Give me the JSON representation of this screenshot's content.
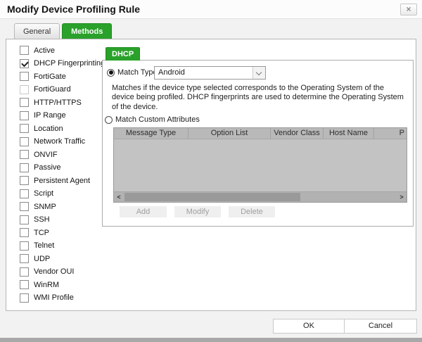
{
  "dialog": {
    "title": "Modify Device Profiling Rule",
    "close_icon": "×"
  },
  "tabs": [
    {
      "label": "General",
      "active": false
    },
    {
      "label": "Methods",
      "active": true
    }
  ],
  "methods": [
    {
      "label": "Active",
      "checked": false,
      "disabled": false
    },
    {
      "label": "DHCP Fingerprinting",
      "checked": true,
      "disabled": false
    },
    {
      "label": "FortiGate",
      "checked": false,
      "disabled": false
    },
    {
      "label": "FortiGuard",
      "checked": false,
      "disabled": true
    },
    {
      "label": "HTTP/HTTPS",
      "checked": false,
      "disabled": false
    },
    {
      "label": "IP Range",
      "checked": false,
      "disabled": false
    },
    {
      "label": "Location",
      "checked": false,
      "disabled": false
    },
    {
      "label": "Network Traffic",
      "checked": false,
      "disabled": false
    },
    {
      "label": "ONVIF",
      "checked": false,
      "disabled": false
    },
    {
      "label": "Passive",
      "checked": false,
      "disabled": false
    },
    {
      "label": "Persistent Agent",
      "checked": false,
      "disabled": false
    },
    {
      "label": "Script",
      "checked": false,
      "disabled": false
    },
    {
      "label": "SNMP",
      "checked": false,
      "disabled": false
    },
    {
      "label": "SSH",
      "checked": false,
      "disabled": false
    },
    {
      "label": "TCP",
      "checked": false,
      "disabled": false
    },
    {
      "label": "Telnet",
      "checked": false,
      "disabled": false
    },
    {
      "label": "UDP",
      "checked": false,
      "disabled": false
    },
    {
      "label": "Vendor OUI",
      "checked": false,
      "disabled": false
    },
    {
      "label": "WinRM",
      "checked": false,
      "disabled": false
    },
    {
      "label": "WMI Profile",
      "checked": false,
      "disabled": false
    }
  ],
  "dhcp": {
    "tab_label": "DHCP",
    "match_type": {
      "label": "Match Type",
      "selected": true,
      "value": "Android"
    },
    "description_lines": [
      "Matches if the device type selected corresponds to the Operating System of the",
      "device being profiled. DHCP fingerprints are used to determine the Operating System",
      "of the device."
    ],
    "match_custom": {
      "label": "Match Custom Attributes",
      "selected": false
    },
    "table": {
      "columns": [
        "Message Type",
        "Option List",
        "Vendor Class",
        "Host Name",
        "P"
      ],
      "rows": [],
      "scroll_left_icon": "<",
      "scroll_right_icon": ">"
    },
    "buttons": {
      "add": "Add",
      "modify": "Modify",
      "delete": "Delete"
    }
  },
  "footer": {
    "ok": "OK",
    "cancel": "Cancel"
  },
  "colors": {
    "accent_green": "#2aa12a",
    "table_header_gray": "#b9b9b9",
    "table_body_gray": "#c3c3c3",
    "disabled_text": "#9f9f9f"
  }
}
